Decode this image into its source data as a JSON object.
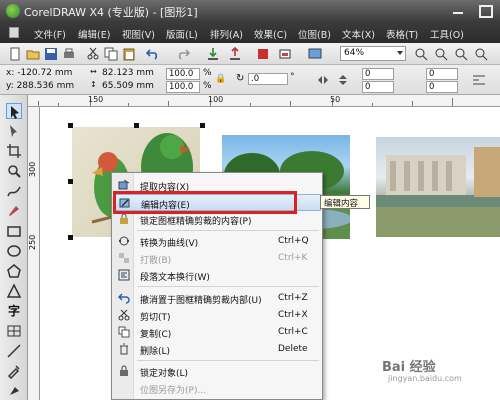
{
  "app": {
    "title": "CorelDRAW X4 (专业版) - [图形1]"
  },
  "menubar": [
    "文件(F)",
    "编辑(E)",
    "视图(V)",
    "版面(L)",
    "排列(A)",
    "效果(C)",
    "位图(B)",
    "文本(X)",
    "表格(T)",
    "工具(O)"
  ],
  "toolbar": {
    "zoom": "64%"
  },
  "propbar": {
    "x": "x: -120.72 mm",
    "y": "y: 288.536 mm",
    "width": "82.123 mm",
    "height": "65.509 mm",
    "scale_x": "100.0",
    "scale_y": "100.0",
    "pct1": "%",
    "pct2": "%",
    "rotation": ".0",
    "degree": "°",
    "n1": "0",
    "n2": "0",
    "n3": "0",
    "n4": "0"
  },
  "ruler": {
    "h_labels": [
      "150",
      "100",
      "50"
    ],
    "v_labels": [
      "300",
      "250"
    ]
  },
  "context_menu": {
    "items": [
      {
        "label": "提取内容(X)",
        "shortcut": "",
        "icon": "extract-icon",
        "disabled": false
      },
      {
        "label": "编辑内容(E)",
        "shortcut": "",
        "icon": "edit-icon",
        "disabled": false,
        "highlighted": true
      },
      {
        "label": "锁定图框精确剪裁的内容(P)",
        "shortcut": "",
        "icon": "lock-icon",
        "disabled": false
      },
      {
        "label": "转换为曲线(V)",
        "shortcut": "Ctrl+Q",
        "icon": "curve-icon",
        "disabled": false
      },
      {
        "label": "打散(B)",
        "shortcut": "Ctrl+K",
        "icon": "break-icon",
        "disabled": true
      },
      {
        "label": "段落文本换行(W)",
        "shortcut": "",
        "icon": "wrap-icon",
        "disabled": false
      },
      {
        "label": "撤消置于图框精确剪裁内部(U)",
        "shortcut": "Ctrl+Z",
        "icon": "undo-icon",
        "disabled": false
      },
      {
        "label": "剪切(T)",
        "shortcut": "Ctrl+X",
        "icon": "scissors-icon",
        "disabled": false
      },
      {
        "label": "复制(C)",
        "shortcut": "Ctrl+C",
        "icon": "copy-icon",
        "disabled": false
      },
      {
        "label": "删除(L)",
        "shortcut": "Delete",
        "icon": "trash-icon",
        "disabled": false
      },
      {
        "label": "锁定对象(L)",
        "shortcut": "",
        "icon": "lock-object-icon",
        "disabled": false
      },
      {
        "label": "位图另存为(P)...",
        "shortcut": "",
        "icon": "",
        "disabled": true
      }
    ]
  },
  "tooltip": "编辑内容",
  "watermark": {
    "line1": "Bai 经验",
    "line2": "jingyan.baidu.com"
  },
  "colors": {
    "highlight_border": "#e02020",
    "menu_highlight": "#c9dcf3"
  }
}
